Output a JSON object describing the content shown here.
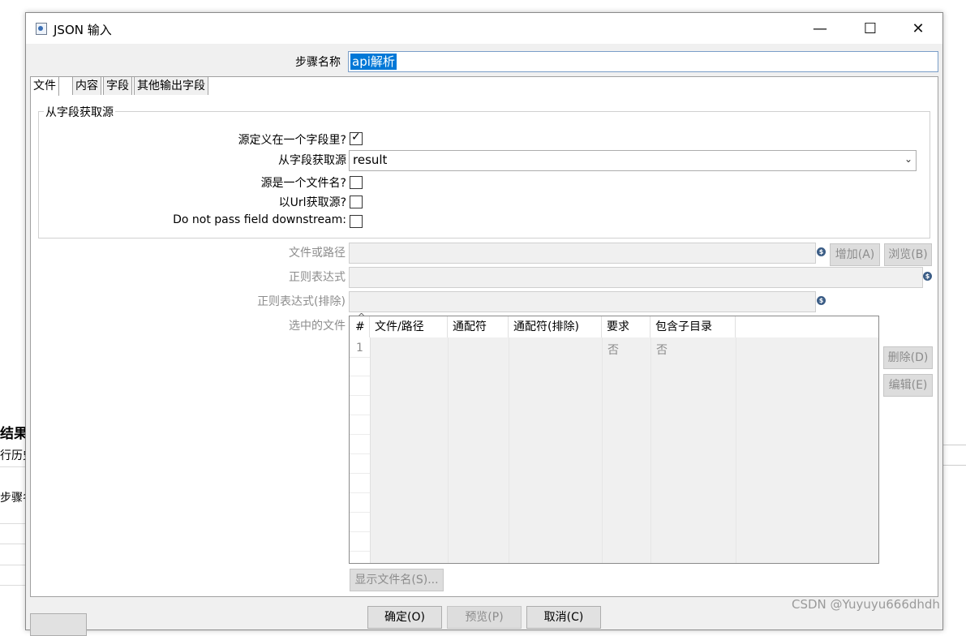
{
  "background": {
    "fragment_1": "结果",
    "fragment_2": "行历史",
    "fragment_3": "步骤名"
  },
  "window": {
    "title": "JSON 输入",
    "minimize_glyph": "—",
    "maximize_glyph": "☐",
    "close_glyph": "✕"
  },
  "step": {
    "label": "步骤名称",
    "value": "api解析"
  },
  "tabs": [
    "文件",
    "内容",
    "字段",
    "其他输出字段"
  ],
  "group": {
    "title": "从字段获取源",
    "source_in_field_label": "源定义在一个字段里?",
    "source_in_field_checked": true,
    "get_source_label": "从字段获取源",
    "get_source_value": "result",
    "source_is_filename_label": "源是一个文件名?",
    "source_is_filename_checked": false,
    "read_url_label": "以Url获取源?",
    "read_url_checked": false,
    "do_not_pass_label": "Do not pass field downstream:",
    "do_not_pass_checked": false
  },
  "file": {
    "file_or_dir_label": "文件或路径",
    "regex_label": "正则表达式",
    "exclude_regex_label": "正则表达式(排除)",
    "selected_files_label": "选中的文件",
    "add_button": "增加(A)",
    "browse_button": "浏览(B)",
    "delete_button": "删除(D)",
    "edit_button": "编辑(E)",
    "show_filenames_button": "显示文件名(S)...",
    "var_icon_glyph": "$"
  },
  "table": {
    "sort_glyph": "^",
    "headers": [
      "#",
      "文件/路径",
      "通配符",
      "通配符(排除)",
      "要求",
      "包含子目录"
    ],
    "rows": [
      {
        "num": "1",
        "path": "",
        "wildcard": "",
        "exclude": "",
        "required": "否",
        "subdirs": "否"
      }
    ]
  },
  "footer": {
    "ok": "确定(O)",
    "preview": "预览(P)",
    "cancel": "取消(C)"
  },
  "watermark": "CSDN @Yuyuyu666dhdh"
}
